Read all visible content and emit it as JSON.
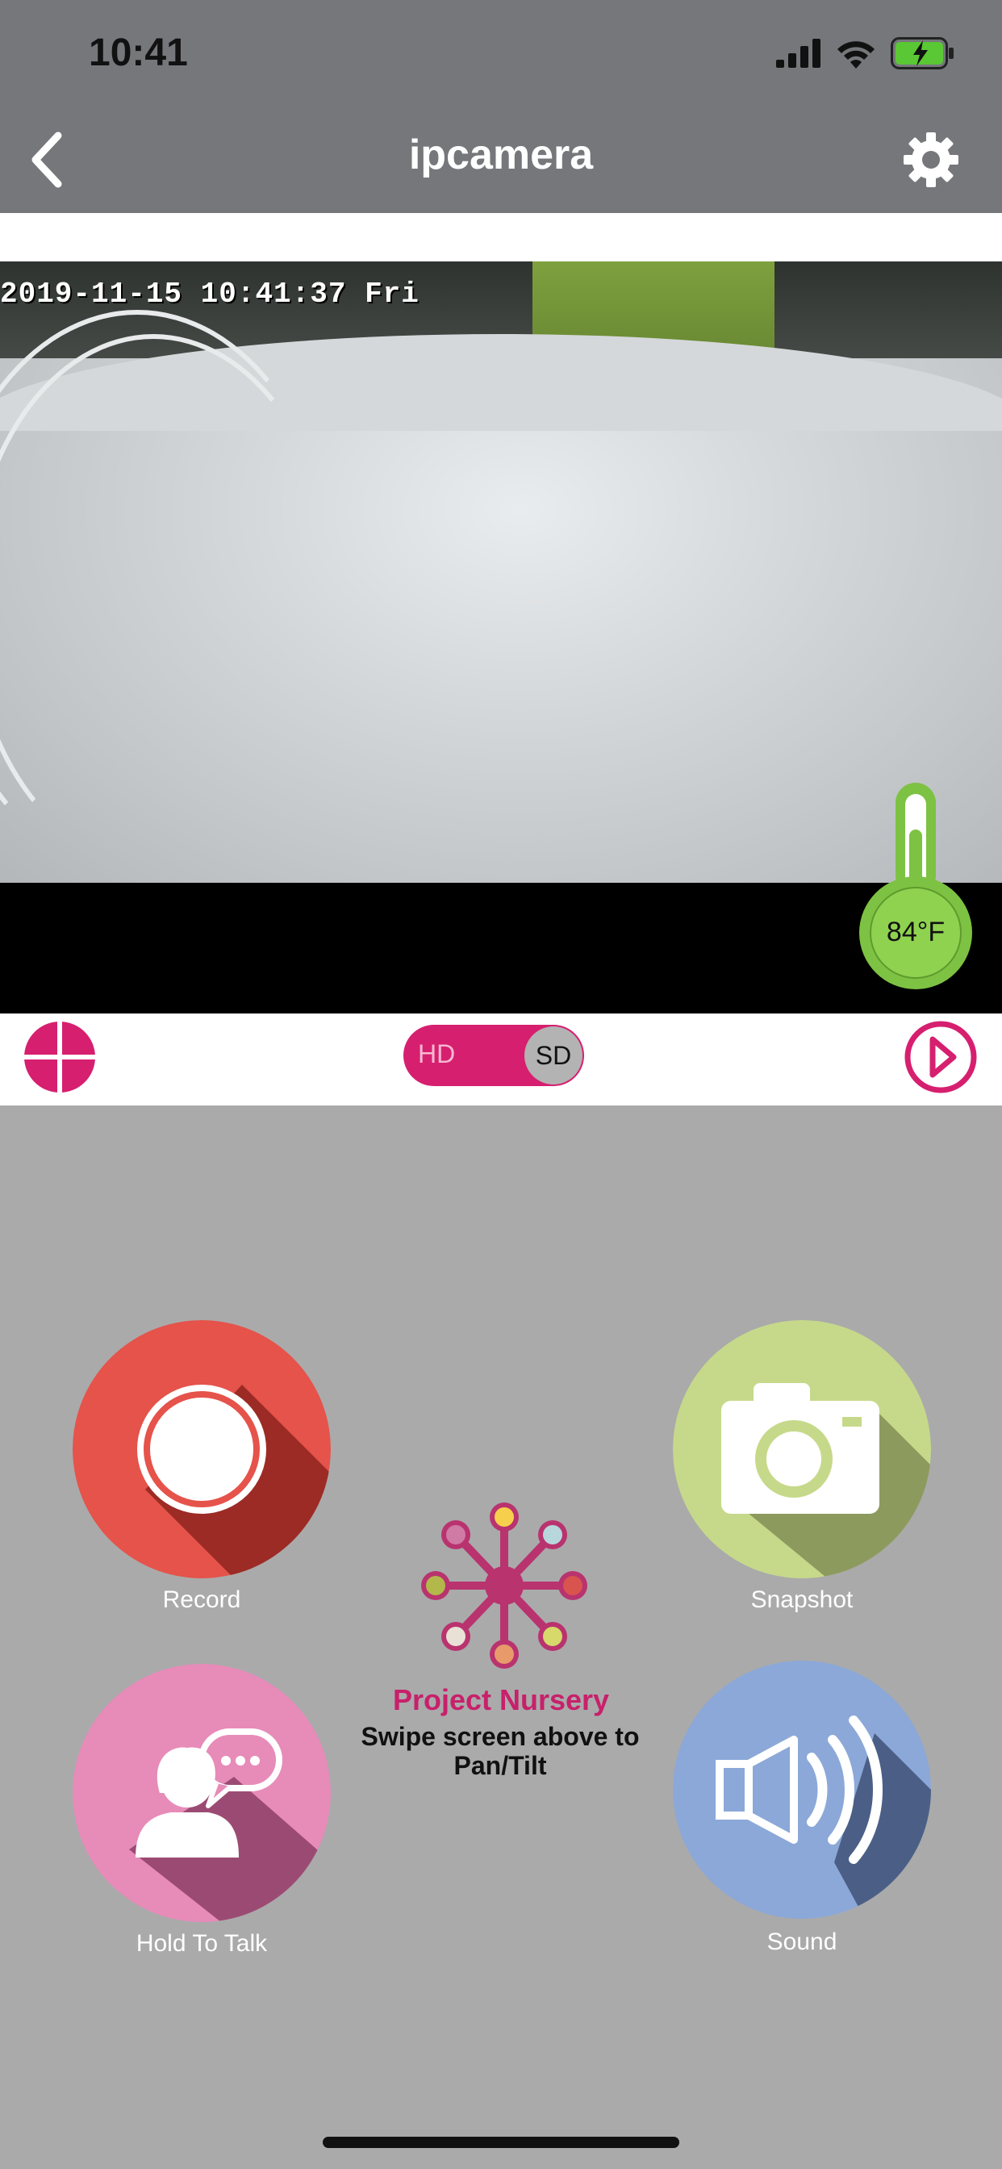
{
  "status_bar": {
    "time": "10:41",
    "icons": [
      "signal-icon",
      "wifi-icon",
      "battery-charging-icon"
    ]
  },
  "nav": {
    "title": "ipcamera",
    "back_icon": "chevron-left-icon",
    "settings_icon": "gear-icon"
  },
  "video": {
    "timestamp": "2019-11-15 10:41:37 Fri",
    "temperature": "84°F"
  },
  "controls": {
    "hd_label": "HD",
    "sd_label": "SD",
    "ptz_icon": "crosshair-icon",
    "playback_icon": "play-icon"
  },
  "actions": {
    "record_label": "Record",
    "snapshot_label": "Snapshot",
    "talk_label": "Hold To Talk",
    "sound_label": "Sound"
  },
  "branding": {
    "name": "Project Nursery",
    "hint": "Swipe screen above to Pan/Tilt"
  },
  "colors": {
    "accent": "#d61f6f",
    "nav_bg": "#76777b",
    "record": "#e5534b",
    "snapshot": "#c6d98a",
    "talk": "#e78bb8",
    "sound": "#8ba8d8",
    "thermometer": "#7dc243"
  }
}
